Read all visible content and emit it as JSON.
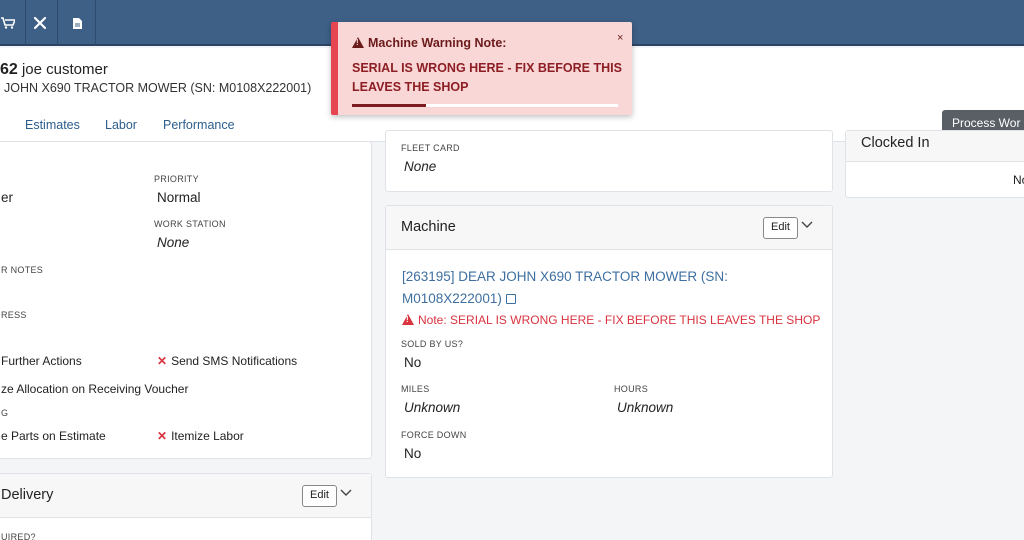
{
  "topbar": {
    "icons": [
      "cart-icon",
      "tools-icon",
      "document-icon"
    ]
  },
  "header": {
    "wo_number": "62",
    "customer": "joe customer",
    "machine_sub": "JOHN X690 TRACTOR MOWER (SN: M0108X222001)",
    "tabs": [
      "Estimates",
      "Labor",
      "Performance"
    ],
    "process_button": "Process Wor"
  },
  "toast": {
    "title": "Machine Warning Note:",
    "message": "SERIAL IS WRONG HERE - FIX BEFORE THIS LEAVES THE SHOP",
    "close": "×",
    "progress": 0.28
  },
  "details": {
    "left_value": "er",
    "priority_label": "PRIORITY",
    "priority_value": "Normal",
    "work_station_label": "WORK STATION",
    "work_station_value": "None",
    "notes_label": "R NOTES",
    "address_label": "RESS",
    "further_actions": "Further Actions",
    "send_sms": "Send SMS Notifications",
    "allocation": "ze Allocation on Receiving Voucher",
    "g_label": "G",
    "parts_estimate": "e Parts on Estimate",
    "itemize_labor": "Itemize Labor",
    "x_mark": "✕"
  },
  "delivery": {
    "title": "Delivery",
    "edit": "Edit",
    "required_label": "UIRED?"
  },
  "fleet": {
    "label": "FLEET CARD",
    "value": "None"
  },
  "machine": {
    "title": "Machine",
    "edit": "Edit",
    "link": "[263195] DEAR JOHN X690 TRACTOR MOWER (SN: M0108X222001)",
    "note": "Note: SERIAL IS WRONG HERE - FIX BEFORE THIS LEAVES THE SHOP",
    "sold_label": "SOLD BY US?",
    "sold_value": "No",
    "miles_label": "MILES",
    "miles_value": "Unknown",
    "hours_label": "HOURS",
    "hours_value": "Unknown",
    "force_label": "FORCE DOWN",
    "force_value": "No"
  },
  "clocked": {
    "title": "Clocked In",
    "value": "No"
  }
}
